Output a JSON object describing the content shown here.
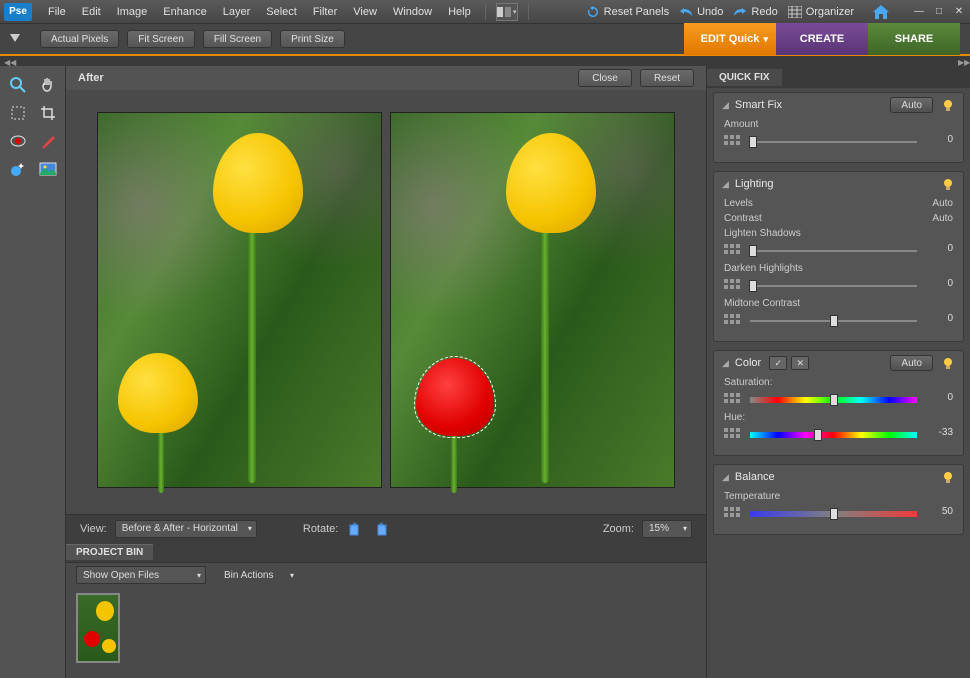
{
  "app": {
    "logo": "Pse"
  },
  "menu": [
    "File",
    "Edit",
    "Image",
    "Enhance",
    "Layer",
    "Select",
    "Filter",
    "View",
    "Window",
    "Help"
  ],
  "topActions": {
    "reset": "Reset Panels",
    "undo": "Undo",
    "redo": "Redo",
    "organizer": "Organizer"
  },
  "options": {
    "actualPixels": "Actual Pixels",
    "fitScreen": "Fit Screen",
    "fillScreen": "Fill Screen",
    "printSize": "Print Size"
  },
  "modes": {
    "edit": "EDIT Quick",
    "create": "CREATE",
    "share": "SHARE"
  },
  "preview": {
    "header": "After",
    "close": "Close",
    "reset": "Reset"
  },
  "viewBar": {
    "viewLabel": "View:",
    "viewValue": "Before & After - Horizontal",
    "rotateLabel": "Rotate:",
    "zoomLabel": "Zoom:",
    "zoomValue": "15%"
  },
  "projectBin": {
    "tab": "PROJECT BIN",
    "showOpen": "Show Open Files",
    "binActions": "Bin Actions"
  },
  "quickFix": {
    "tab": "QUICK FIX",
    "smartFix": {
      "title": "Smart Fix",
      "auto": "Auto",
      "amount": "Amount",
      "amountValue": "0"
    },
    "lighting": {
      "title": "Lighting",
      "levels": "Levels",
      "levelsAuto": "Auto",
      "contrast": "Contrast",
      "contrastAuto": "Auto",
      "lighten": "Lighten Shadows",
      "lightenValue": "0",
      "darken": "Darken Highlights",
      "darkenValue": "0",
      "midtone": "Midtone Contrast",
      "midtoneValue": "0"
    },
    "color": {
      "title": "Color",
      "auto": "Auto",
      "saturation": "Saturation:",
      "saturationValue": "0",
      "hue": "Hue:",
      "hueValue": "-33"
    },
    "balance": {
      "title": "Balance",
      "temperature": "Temperature",
      "temperatureValue": "50"
    }
  }
}
